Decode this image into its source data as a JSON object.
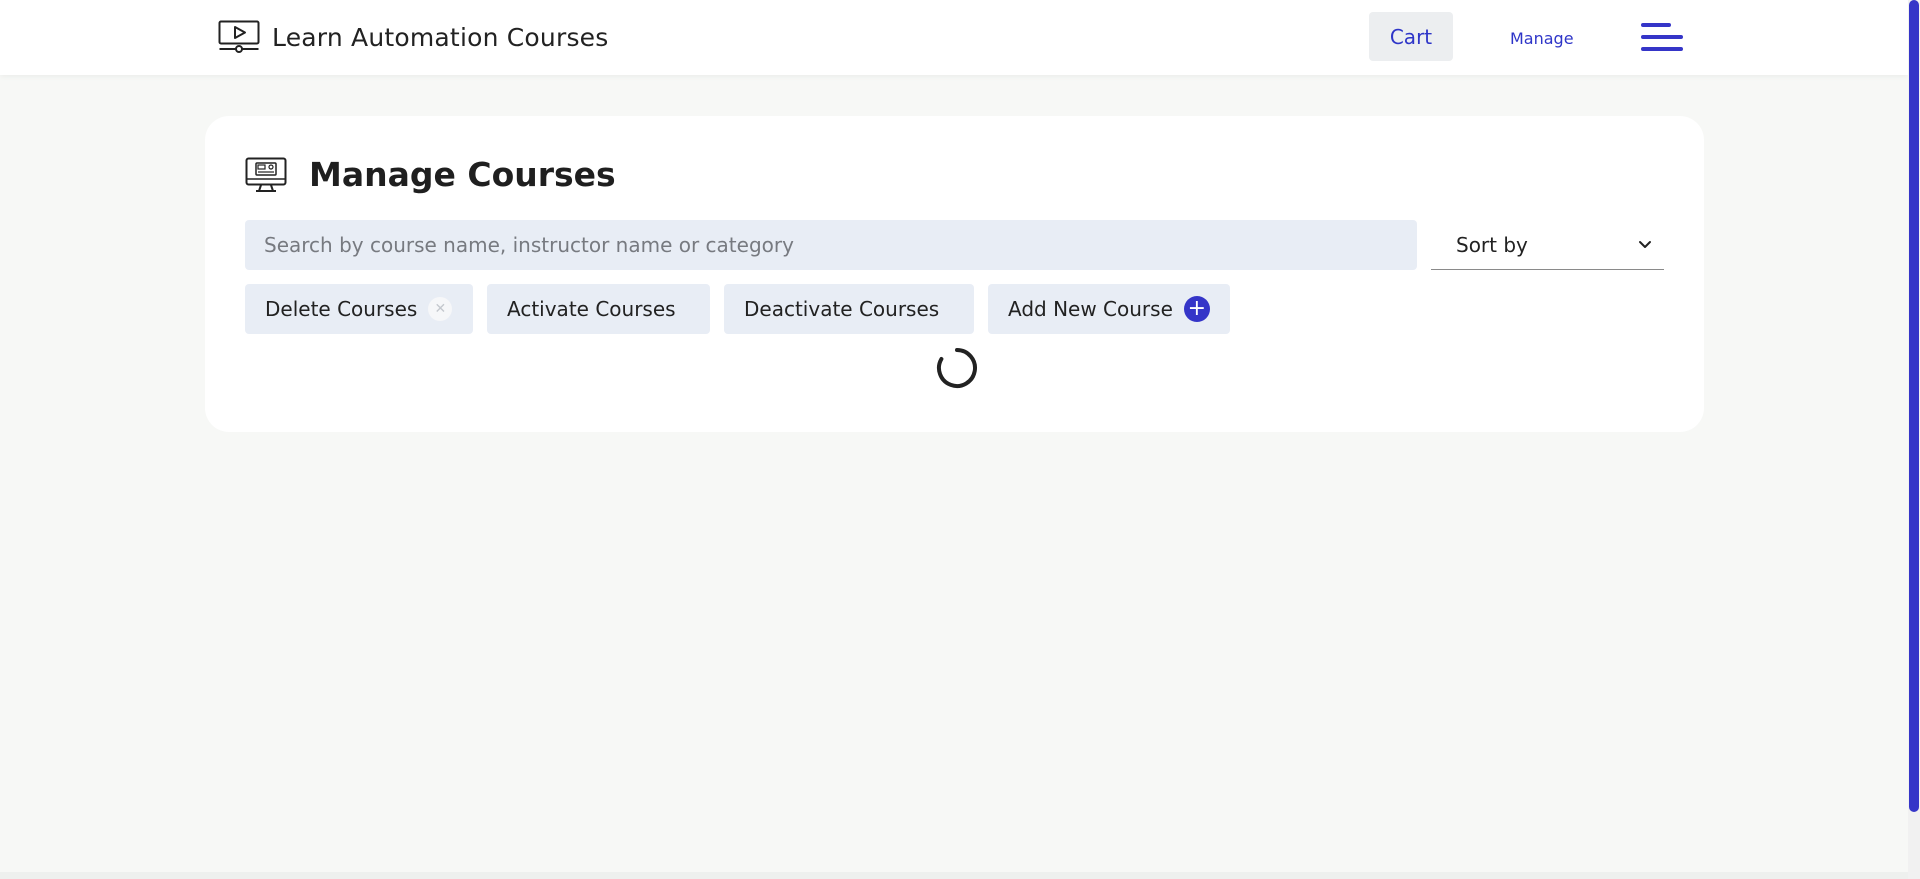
{
  "navbar": {
    "brand_title": "Learn Automation Courses",
    "brand_icon": "video-player-icon",
    "cart_label": "Cart",
    "manage_label": "Manage",
    "menu_icon": "hamburger-menu-icon"
  },
  "main": {
    "title": "Manage Courses",
    "title_icon": "monitor-dashboard-icon",
    "search": {
      "placeholder": "Search by course name, instructor name or category",
      "value": ""
    },
    "sort": {
      "selected": "Sort by",
      "icon": "chevron-down-icon"
    },
    "actions": {
      "delete_label": "Delete Courses",
      "activate_label": "Activate Courses",
      "deactivate_label": "Deactivate Courses",
      "add_label": "Add New Course"
    },
    "loading": true
  },
  "colors": {
    "accent": "#3535c8",
    "link": "#2e35c8",
    "background": "#f7f8f6",
    "input_bg": "#e8edf5"
  }
}
